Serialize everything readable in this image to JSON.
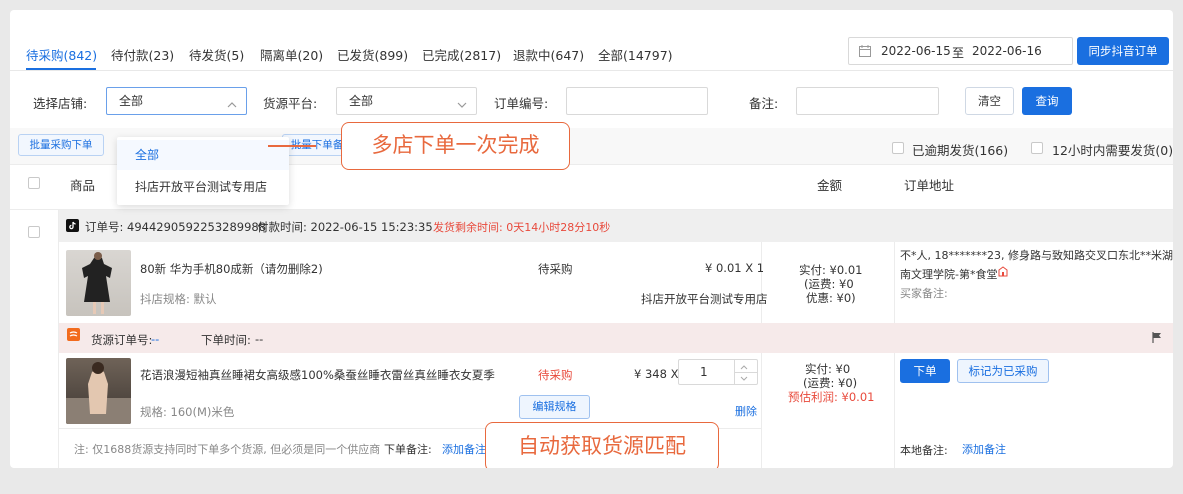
{
  "tabs": [
    {
      "label": "待采购(842)",
      "active": true
    },
    {
      "label": "待付款(23)"
    },
    {
      "label": "待发货(5)"
    },
    {
      "label": "隔离单(20)"
    },
    {
      "label": "已发货(899)"
    },
    {
      "label": "已完成(2817)"
    },
    {
      "label": "退款中(647)"
    },
    {
      "label": "全部(14797)"
    }
  ],
  "date_range": {
    "start": "2022-06-15",
    "sep": "至",
    "end": "2022-06-16"
  },
  "sync_button": "同步抖音订单",
  "filters": {
    "shop_label": "选择店铺:",
    "shop_value": "全部",
    "platform_label": "货源平台:",
    "platform_value": "全部",
    "order_no_label": "订单编号:",
    "remark_label": "备注:",
    "clear_button": "清空",
    "search_button": "查询"
  },
  "shop_dropdown": {
    "options": [
      "全部",
      "抖店开放平台测试专用店"
    ]
  },
  "actions": {
    "batch_purchase": "批量采购下单",
    "batch_order": "批量下单备",
    "overdue": "已逾期发货(166)",
    "within12h": "12小时内需要发货(0)"
  },
  "table_headers": {
    "product": "商品",
    "amount": "金额",
    "address": "订单地址"
  },
  "order": {
    "order_no": "订单号: 4944290592253289988",
    "pay_time": "付款时间: 2022-06-15 15:23:35",
    "remaining": "发货剩余时间: 0天14小时28分10秒",
    "product_title": "80新 华为手机80成新（请勿删除2)",
    "product_spec": "抖店规格: 默认",
    "status": "待采购",
    "price_qty": "¥ 0.01 X 1",
    "shop_name": "抖店开放平台测试专用店",
    "paid": "实付: ¥0.01",
    "shipping": "(运费: ¥0",
    "discount": "优惠: ¥0)",
    "address_line1": "不*人,  18*******23,  修身路与致知路交叉口东北**米湖",
    "address_line2": "南文理学院-第*食堂",
    "buyer_remark": "买家备注:"
  },
  "source": {
    "source_order_label": "货源订单号:",
    "source_order_value": "--",
    "order_time_label": "下单时间:",
    "order_time_value": "--",
    "product_title": "花语浪漫短袖真丝睡裙女高级感100%桑蚕丝睡衣雷丝真丝睡衣女夏季",
    "product_spec": "规格: 160(M)米色",
    "status": "待采购",
    "price": "¥ 348 X",
    "quantity": "1",
    "edit_spec": "编辑规格",
    "delete": "删除",
    "paid": "实付: ¥0",
    "shipping": "(运费: ¥0)",
    "profit": "预估利润: ¥0.01",
    "order_button": "下单",
    "mark_purchased": "标记为已采购",
    "note": "注: 仅1688货源支持同时下单多个货源, 但必须是同一个供应商",
    "order_remark_label": "下单备注:",
    "add_remark": "添加备注",
    "local_remark_label": "本地备注:",
    "local_add_remark": "添加备注"
  },
  "callouts": {
    "top": "多店下单一次完成",
    "bottom": "自动获取货源匹配"
  },
  "colors": {
    "primary": "#1a6fe0",
    "accent": "#e8693e",
    "danger": "#e84a3c"
  }
}
